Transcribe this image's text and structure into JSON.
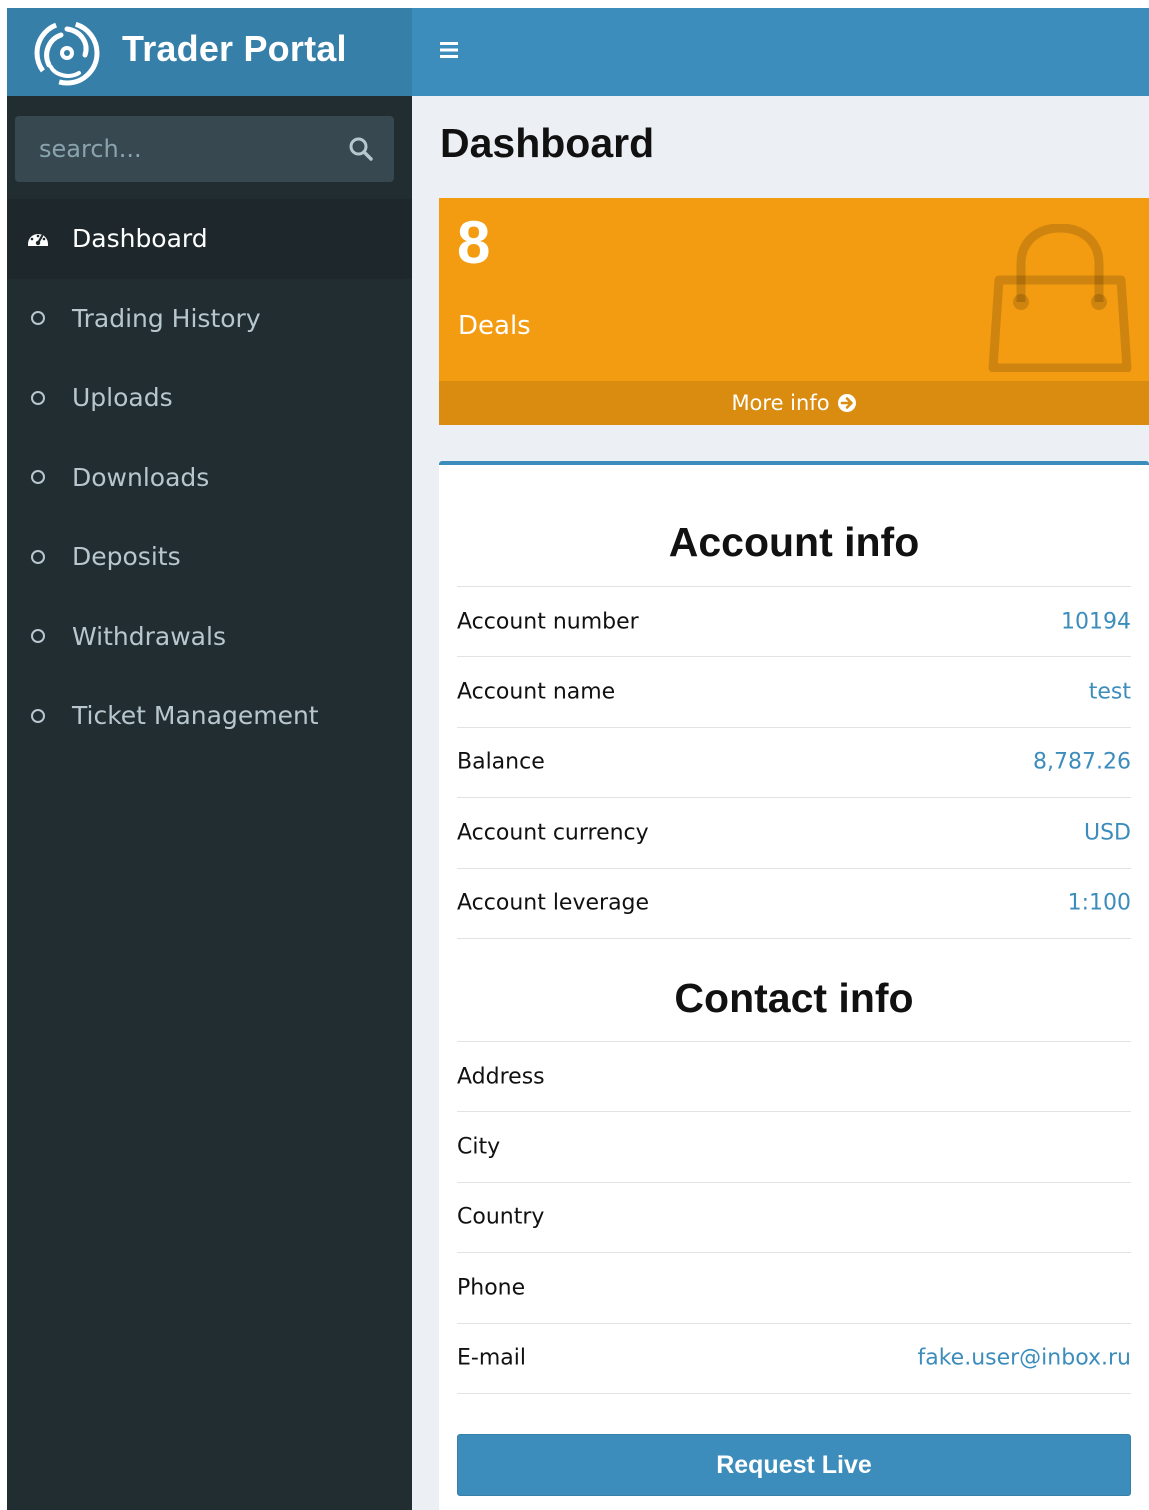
{
  "brand": {
    "title": "Trader Portal"
  },
  "search": {
    "placeholder": "search..."
  },
  "sidebar": {
    "items": [
      {
        "label": "Dashboard",
        "icon": "dashboard-icon",
        "active": true
      },
      {
        "label": "Trading History",
        "icon": "circle-icon"
      },
      {
        "label": "Uploads",
        "icon": "circle-icon"
      },
      {
        "label": "Downloads",
        "icon": "circle-icon"
      },
      {
        "label": "Deposits",
        "icon": "circle-icon"
      },
      {
        "label": "Withdrawals",
        "icon": "circle-icon"
      },
      {
        "label": "Ticket Management",
        "icon": "circle-icon"
      }
    ]
  },
  "page": {
    "title": "Dashboard"
  },
  "deals": {
    "count": "8",
    "label": "Deals",
    "more_info": "More info"
  },
  "account": {
    "title": "Account info",
    "rows": [
      {
        "label": "Account number",
        "value": "10194"
      },
      {
        "label": "Account name",
        "value": "test"
      },
      {
        "label": "Balance",
        "value": "8,787.26"
      },
      {
        "label": "Account currency",
        "value": "USD"
      },
      {
        "label": "Account leverage",
        "value": "1:100"
      }
    ]
  },
  "contact": {
    "title": "Contact info",
    "rows": [
      {
        "label": "Address",
        "value": ""
      },
      {
        "label": "City",
        "value": ""
      },
      {
        "label": "Country",
        "value": ""
      },
      {
        "label": "Phone",
        "value": ""
      },
      {
        "label": "E-mail",
        "value": "fake.user@inbox.ru"
      }
    ]
  },
  "actions": {
    "request_live": "Request Live"
  },
  "colors": {
    "navbar": "#3c8dbc",
    "brand": "#367fa9",
    "sidebar": "#222d32",
    "deals_box": "#f39c12",
    "accent_text": "#3c8dbc"
  }
}
